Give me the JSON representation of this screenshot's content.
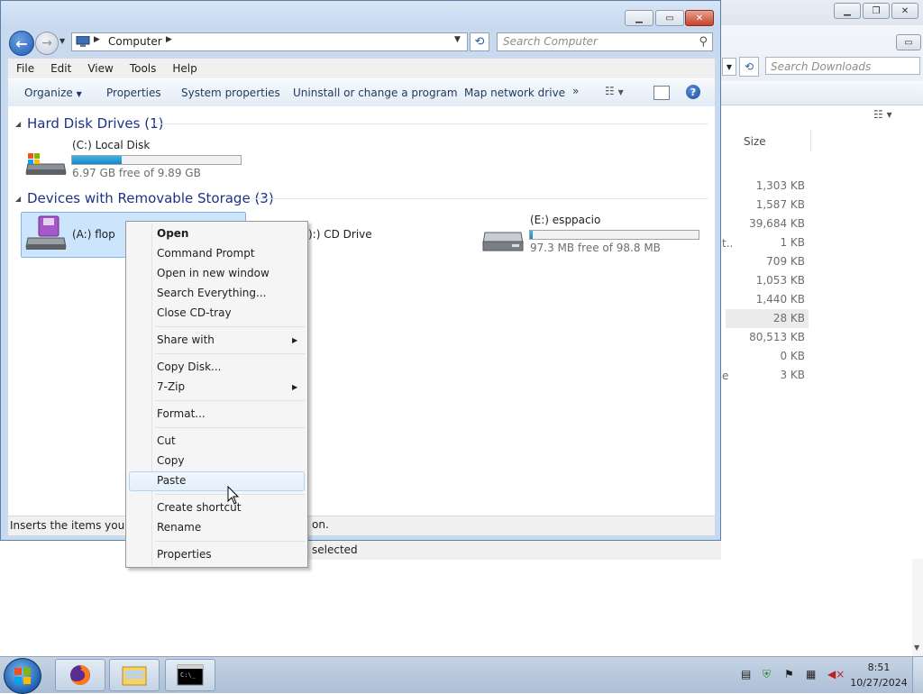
{
  "background_window": {
    "search_placeholder": "Search Downloads",
    "column_size": "Size",
    "sizes": [
      "1,303 KB",
      "1,587 KB",
      "39,684 KB",
      "1 KB",
      "709 KB",
      "1,053 KB",
      "1,440 KB",
      "28 KB",
      "80,513 KB",
      "0 KB",
      "3 KB"
    ],
    "name_fragments": [
      "t..",
      "e"
    ],
    "status_text": "selected"
  },
  "main_window": {
    "breadcrumb": "Computer",
    "search_placeholder": "Search Computer",
    "menu": [
      "File",
      "Edit",
      "View",
      "Tools",
      "Help"
    ],
    "commands": [
      "Organize",
      "Properties",
      "System properties",
      "Uninstall or change a program",
      "Map network drive"
    ],
    "more_symbol": "»",
    "groups": [
      {
        "title": "Hard Disk Drives (1)"
      },
      {
        "title": "Devices with Removable Storage (3)"
      }
    ],
    "drives": {
      "c": {
        "name": "(C:) Local Disk",
        "free_text": "6.97 GB free of 9.89 GB",
        "used_fraction": 0.295
      },
      "a": {
        "name": "(A:) flop"
      },
      "d": {
        "name": "(D:) CD Drive",
        "visible_name": "):) CD Drive"
      },
      "e": {
        "name": "(E:) esppacio",
        "free_text": "97.3 MB free of 98.8 MB",
        "used_fraction": 0.015
      }
    },
    "status_text": "Inserts the items you hav",
    "status_text_end": "on."
  },
  "context_menu": {
    "items": [
      "Open",
      "Command Prompt",
      "Open in new window",
      "Search Everything...",
      "Close CD-tray",
      "Share with",
      "Copy Disk...",
      "7-Zip",
      "Format...",
      "Cut",
      "Copy",
      "Paste",
      "Create shortcut",
      "Rename",
      "Properties"
    ],
    "hovered": "Paste"
  },
  "taskbar": {
    "time": "8:51",
    "date": "10/27/2024"
  },
  "colors": {
    "accent": "#1e3287",
    "bar_fill": "#26a0da",
    "selection": "#cce4fc"
  }
}
